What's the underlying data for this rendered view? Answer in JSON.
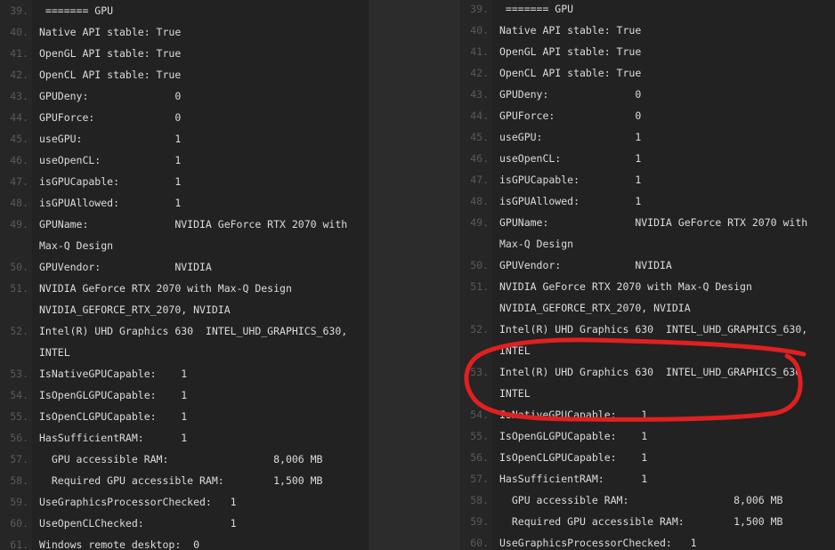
{
  "left_pane": {
    "lines": [
      {
        "n": "39.",
        "t": " ======= GPU"
      },
      {
        "n": "40.",
        "t": "Native API stable: True"
      },
      {
        "n": "41.",
        "t": "OpenGL API stable: True"
      },
      {
        "n": "42.",
        "t": "OpenCL API stable: True"
      },
      {
        "n": "43.",
        "t": "GPUDeny:              0"
      },
      {
        "n": "44.",
        "t": "GPUForce:             0"
      },
      {
        "n": "45.",
        "t": "useGPU:               1"
      },
      {
        "n": "46.",
        "t": "useOpenCL:            1"
      },
      {
        "n": "47.",
        "t": "isGPUCapable:         1"
      },
      {
        "n": "48.",
        "t": "isGPUAllowed:         1"
      },
      {
        "n": "49.",
        "t": "GPUName:              NVIDIA GeForce RTX 2070 with"
      },
      {
        "n": "",
        "t": "Max-Q Design"
      },
      {
        "n": "50.",
        "t": "GPUVendor:            NVIDIA"
      },
      {
        "n": "51.",
        "t": "NVIDIA GeForce RTX 2070 with Max-Q Design"
      },
      {
        "n": "",
        "t": "NVIDIA_GEFORCE_RTX_2070, NVIDIA"
      },
      {
        "n": "52.",
        "t": "Intel(R) UHD Graphics 630  INTEL_UHD_GRAPHICS_630,"
      },
      {
        "n": "",
        "t": "INTEL"
      },
      {
        "n": "53.",
        "t": "IsNativeGPUCapable:    1"
      },
      {
        "n": "54.",
        "t": "IsOpenGLGPUCapable:    1"
      },
      {
        "n": "55.",
        "t": "IsOpenCLGPUCapable:    1"
      },
      {
        "n": "56.",
        "t": "HasSufficientRAM:      1"
      },
      {
        "n": "57.",
        "t": "  GPU accessible RAM:                 8,006 MB"
      },
      {
        "n": "58.",
        "t": "  Required GPU accessible RAM:        1,500 MB"
      },
      {
        "n": "59.",
        "t": "UseGraphicsProcessorChecked:   1"
      },
      {
        "n": "60.",
        "t": "UseOpenCLChecked:              1"
      },
      {
        "n": "61.",
        "t": "Windows remote desktop:  0"
      }
    ]
  },
  "right_pane": {
    "lines": [
      {
        "n": "39.",
        "t": " ======= GPU"
      },
      {
        "n": "40.",
        "t": "Native API stable: True"
      },
      {
        "n": "41.",
        "t": "OpenGL API stable: True"
      },
      {
        "n": "42.",
        "t": "OpenCL API stable: True"
      },
      {
        "n": "43.",
        "t": "GPUDeny:              0"
      },
      {
        "n": "44.",
        "t": "GPUForce:             0"
      },
      {
        "n": "45.",
        "t": "useGPU:               1"
      },
      {
        "n": "46.",
        "t": "useOpenCL:            1"
      },
      {
        "n": "47.",
        "t": "isGPUCapable:         1"
      },
      {
        "n": "48.",
        "t": "isGPUAllowed:         1"
      },
      {
        "n": "49.",
        "t": "GPUName:              NVIDIA GeForce RTX 2070 with"
      },
      {
        "n": "",
        "t": "Max-Q Design"
      },
      {
        "n": "50.",
        "t": "GPUVendor:            NVIDIA"
      },
      {
        "n": "51.",
        "t": "NVIDIA GeForce RTX 2070 with Max-Q Design"
      },
      {
        "n": "",
        "t": "NVIDIA_GEFORCE_RTX_2070, NVIDIA"
      },
      {
        "n": "52.",
        "t": "Intel(R) UHD Graphics 630  INTEL_UHD_GRAPHICS_630,"
      },
      {
        "n": "",
        "t": "INTEL"
      },
      {
        "n": "53.",
        "t": "Intel(R) UHD Graphics 630  INTEL_UHD_GRAPHICS_630"
      },
      {
        "n": "",
        "t": "INTEL"
      },
      {
        "n": "54.",
        "t": "IsNativeGPUCapable:    1"
      },
      {
        "n": "55.",
        "t": "IsOpenGLGPUCapable:    1"
      },
      {
        "n": "56.",
        "t": "IsOpenCLGPUCapable:    1"
      },
      {
        "n": "57.",
        "t": "HasSufficientRAM:      1"
      },
      {
        "n": "58.",
        "t": "  GPU accessible RAM:                 8,006 MB"
      },
      {
        "n": "59.",
        "t": "  Required GPU accessible RAM:        1,500 MB"
      },
      {
        "n": "60.",
        "t": "UseGraphicsProcessorChecked:   1"
      }
    ]
  },
  "annotation": {
    "stroke_color": "#e02020",
    "line_numbers_color": "#5a5a5a",
    "text_color": "#dcdcdc"
  }
}
